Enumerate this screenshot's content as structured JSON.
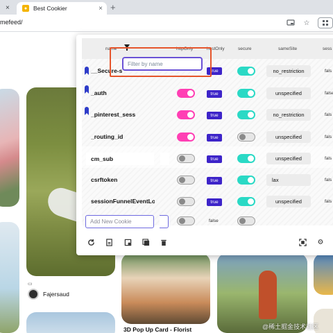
{
  "browser": {
    "prev_tab_close": "×",
    "active_tab": {
      "title": "Best Cookier",
      "close": "×"
    },
    "new_tab": "+",
    "url": "mefeed/",
    "icons": [
      "cast-icon",
      "star-icon",
      "extension-icon"
    ]
  },
  "background_page": {
    "pinner_name": "Fajersaud",
    "pin_title": "3D Pop Up Card - Florist",
    "watermark": "@稀土掘金技术社区"
  },
  "cookie_panel": {
    "columns": {
      "name": "name",
      "httpOnly": "httpOnly",
      "hostOnly": "hostOnly",
      "secure": "secure",
      "sameSite": "sameSite",
      "session": "sess"
    },
    "filter": {
      "placeholder": "Filter by name",
      "value": ""
    },
    "rows": [
      {
        "name": "__Secure-s",
        "pinned": true,
        "httpOnly": null,
        "hostOnly": "true",
        "secure": true,
        "sameSite": "no_restriction",
        "session": "fals"
      },
      {
        "name": "_auth",
        "pinned": true,
        "httpOnly": true,
        "hostOnly": "true",
        "secure": true,
        "sameSite": "unspecified",
        "session": "false"
      },
      {
        "name": "_pinterest_sess",
        "pinned": true,
        "httpOnly": true,
        "hostOnly": "true",
        "secure": true,
        "sameSite": "no_restriction",
        "session": "fals"
      },
      {
        "name": "_routing_id",
        "pinned": false,
        "httpOnly": true,
        "hostOnly": "true",
        "secure": false,
        "sameSite": "unspecified",
        "session": "fals"
      },
      {
        "name": "cm_sub",
        "pinned": false,
        "editing": true,
        "httpOnly": false,
        "hostOnly": "true",
        "secure": true,
        "sameSite": "unspecified",
        "session": "fals"
      },
      {
        "name": "csrftoken",
        "pinned": false,
        "httpOnly": false,
        "hostOnly": "true",
        "secure": true,
        "sameSite": "lax",
        "session": "fals"
      },
      {
        "name": "sessionFunnelEventLo",
        "pinned": false,
        "httpOnly": false,
        "hostOnly": "true",
        "secure": true,
        "sameSite": "unspecified",
        "session": "fals"
      }
    ],
    "new_cookie": {
      "placeholder": "Add New Cookie",
      "hostOnly": "false"
    },
    "footer_icons": [
      "refresh-icon",
      "import-icon",
      "export-icon",
      "copy-icon",
      "delete-icon",
      "fullscreen-icon",
      "settings-icon"
    ],
    "accent_colors": {
      "pink": "#ff3fb4",
      "teal": "#2ad9c5",
      "indigo": "#3d24c9",
      "highlight": "#e5552c"
    }
  }
}
